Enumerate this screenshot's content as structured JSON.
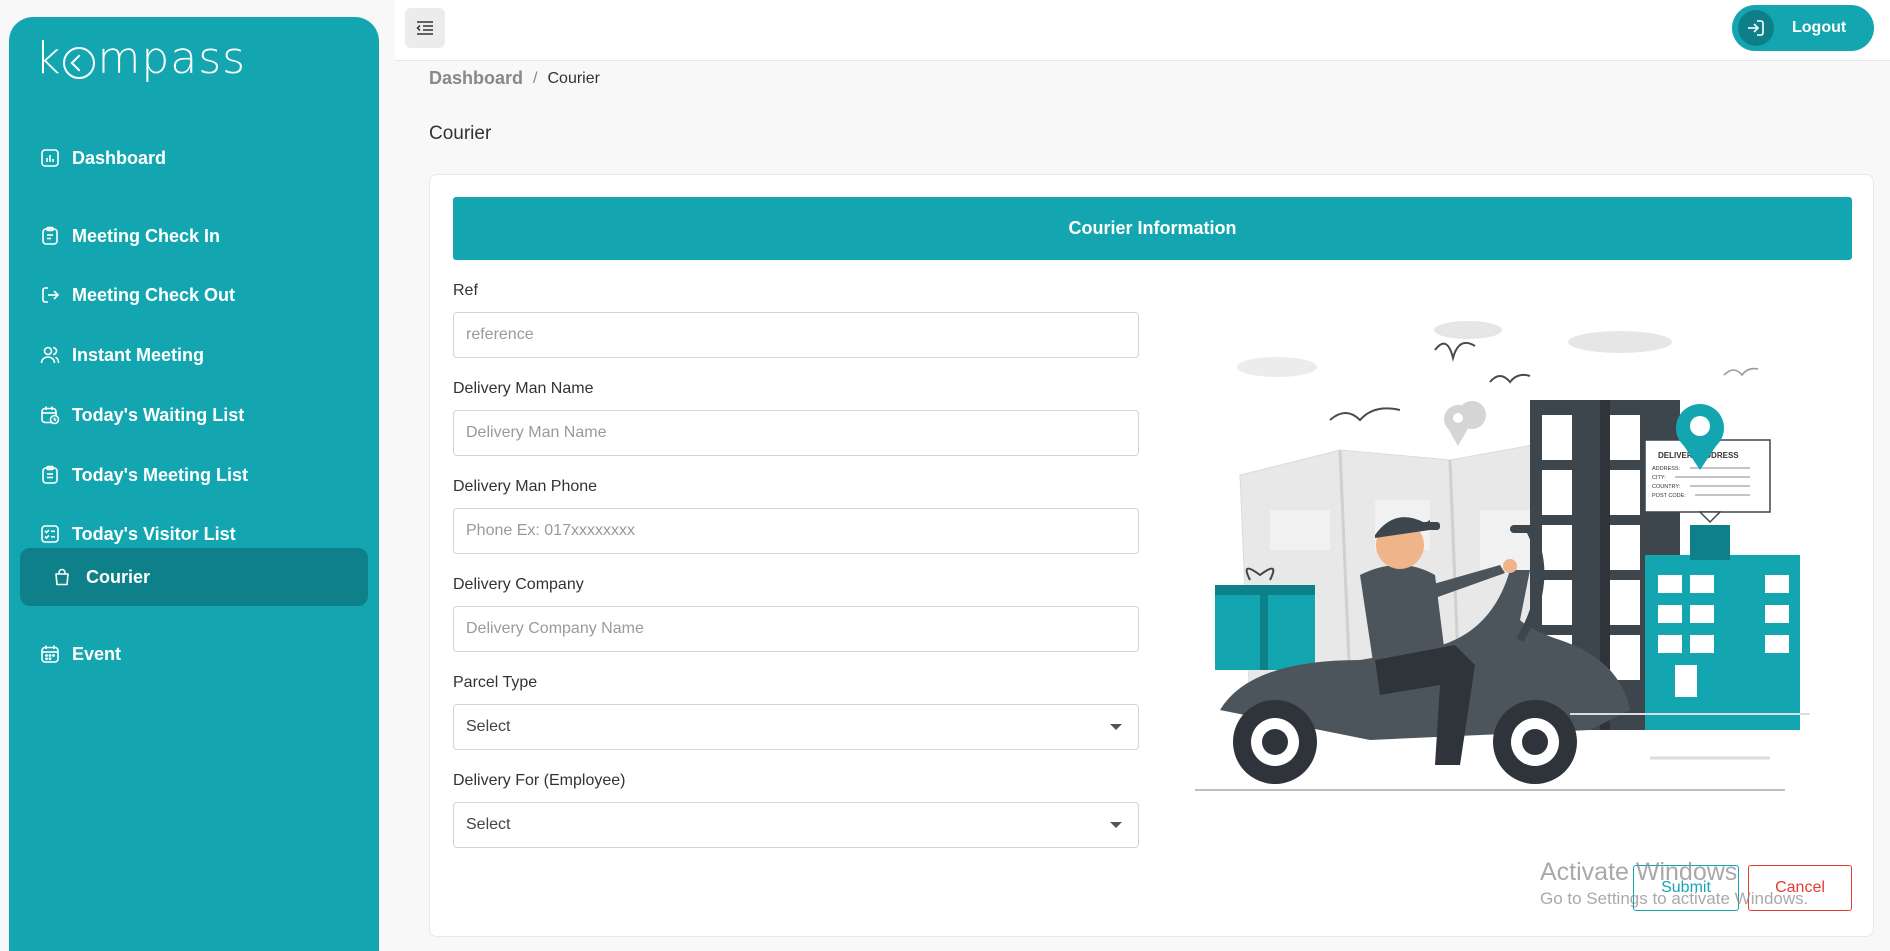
{
  "app": {
    "logo_text_left": "k",
    "logo_text_right": "mpass"
  },
  "sidebar": {
    "items": [
      {
        "label": "Dashboard",
        "icon": "chart-icon"
      },
      {
        "label": "Meeting Check In",
        "icon": "clipboard-icon"
      },
      {
        "label": "Meeting Check Out",
        "icon": "logout-arrow-icon"
      },
      {
        "label": "Instant Meeting",
        "icon": "users-icon"
      },
      {
        "label": "Today's Waiting List",
        "icon": "calendar-clock-icon"
      },
      {
        "label": "Today's Meeting List",
        "icon": "clipboard-list-icon"
      },
      {
        "label": "Today's Visitor List",
        "icon": "checklist-icon"
      },
      {
        "label": "Courier",
        "icon": "bag-icon",
        "active": true
      },
      {
        "label": "Event",
        "icon": "calendar-icon"
      }
    ]
  },
  "topbar": {
    "logout_label": "Logout"
  },
  "breadcrumb": {
    "root": "Dashboard",
    "separator": "/",
    "current": "Courier"
  },
  "page": {
    "title": "Courier"
  },
  "form": {
    "header": "Courier Information",
    "ref": {
      "label": "Ref",
      "placeholder": "reference"
    },
    "delivery_man_name": {
      "label": "Delivery Man Name",
      "placeholder": "Delivery Man Name"
    },
    "delivery_man_phone": {
      "label": "Delivery Man Phone",
      "placeholder": "Phone Ex: 017xxxxxxxx"
    },
    "delivery_company": {
      "label": "Delivery Company",
      "placeholder": "Delivery Company Name"
    },
    "parcel_type": {
      "label": "Parcel Type",
      "value": "Select"
    },
    "delivery_for": {
      "label": "Delivery For (Employee)",
      "value": "Select"
    },
    "submit_label": "Submit",
    "cancel_label": "Cancel"
  },
  "illustration": {
    "delivery_card_title": "DELIVERY ADDRESS",
    "delivery_card_lines": [
      "ADDRESS:",
      "CITY:",
      "COUNTRY:",
      "POST CODE:"
    ]
  },
  "watermark": {
    "line1": "Activate Windows",
    "line2": "Go to Settings to activate Windows."
  },
  "colors": {
    "primary": "#14a6b0",
    "primary_dark": "#0e8089",
    "danger": "#e53935"
  }
}
